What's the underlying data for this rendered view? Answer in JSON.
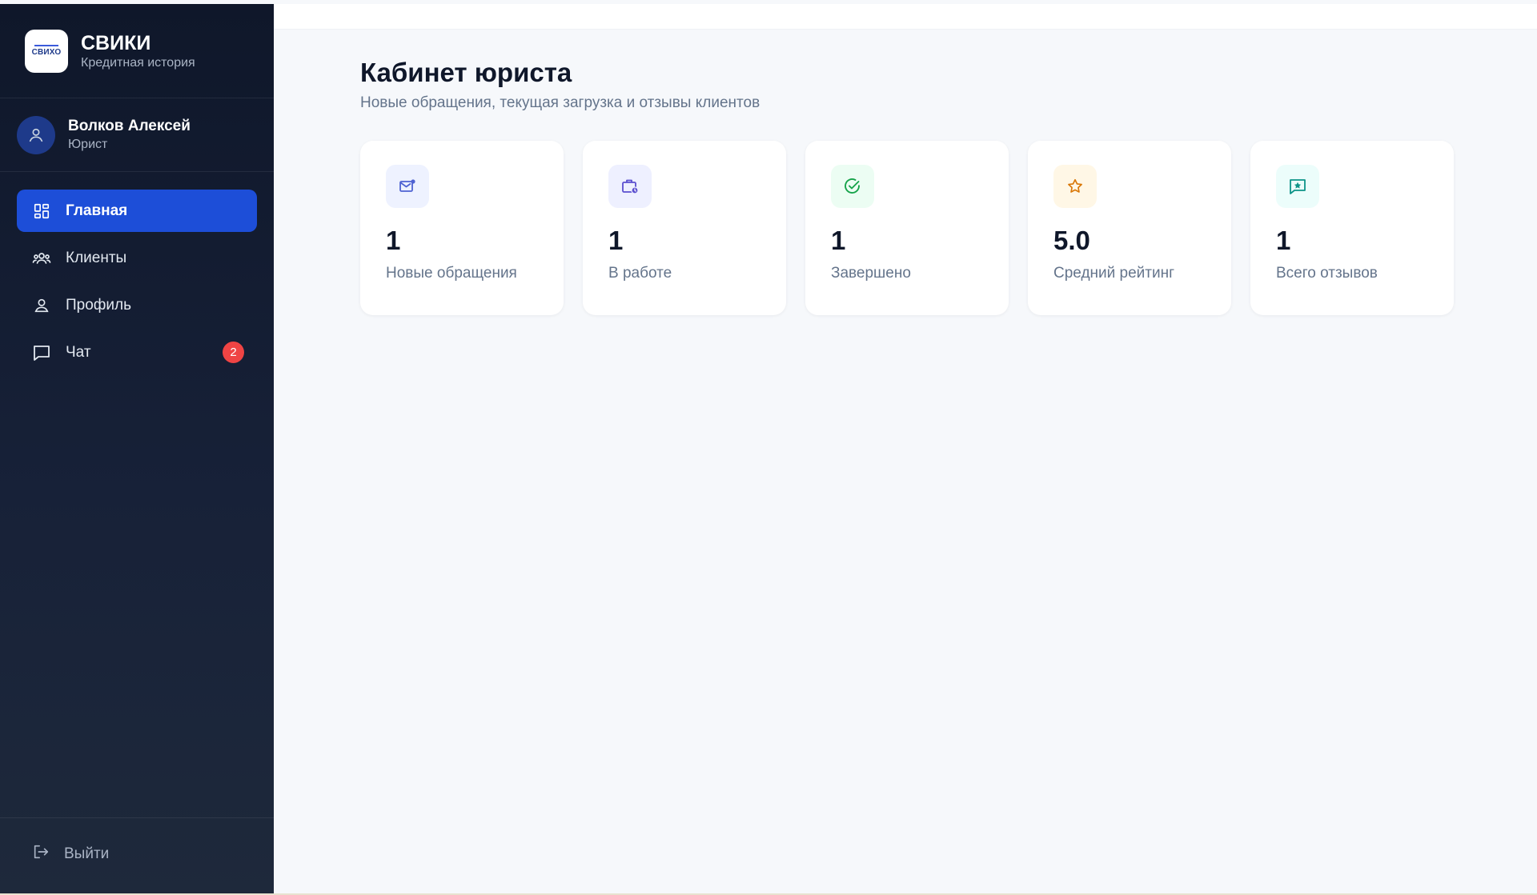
{
  "brand": {
    "logo_text": "СВИХО",
    "title": "СВИКИ",
    "subtitle": "Кредитная история"
  },
  "user": {
    "name": "Волков Алексей",
    "role": "Юрист"
  },
  "nav": {
    "items": [
      {
        "label": "Главная",
        "icon": "dashboard-grid-icon",
        "active": true
      },
      {
        "label": "Клиенты",
        "icon": "users-group-icon"
      },
      {
        "label": "Профиль",
        "icon": "user-icon"
      },
      {
        "label": "Чат",
        "icon": "chat-icon",
        "badge": "2"
      }
    ],
    "logout_label": "Выйти"
  },
  "page": {
    "title": "Кабинет юриста",
    "subtitle": "Новые обращения, текущая загрузка и отзывы клиентов"
  },
  "stats": [
    {
      "value": "1",
      "label": "Новые обращения",
      "icon": "mail-icon",
      "icon_color": "#4f63d2",
      "icon_bg": "#eef2ff"
    },
    {
      "value": "1",
      "label": "В работе",
      "icon": "briefcase-clock-icon",
      "icon_color": "#5b4fcf",
      "icon_bg": "#eef0ff"
    },
    {
      "value": "1",
      "label": "Завершено",
      "icon": "check-circle-icon",
      "icon_color": "#16a34a",
      "icon_bg": "#ecfdf3"
    },
    {
      "value": "5.0",
      "label": "Средний рейтинг",
      "icon": "star-icon",
      "icon_color": "#d97706",
      "icon_bg": "#fff7e6"
    },
    {
      "value": "1",
      "label": "Всего отзывов",
      "icon": "message-star-icon",
      "icon_color": "#0d9488",
      "icon_bg": "#ecfdfb"
    }
  ],
  "colors": {
    "sidebar_bg": "#0f172a",
    "active_nav": "#1d4ed8",
    "badge": "#ef4444",
    "page_bg": "#f6f8fb"
  }
}
